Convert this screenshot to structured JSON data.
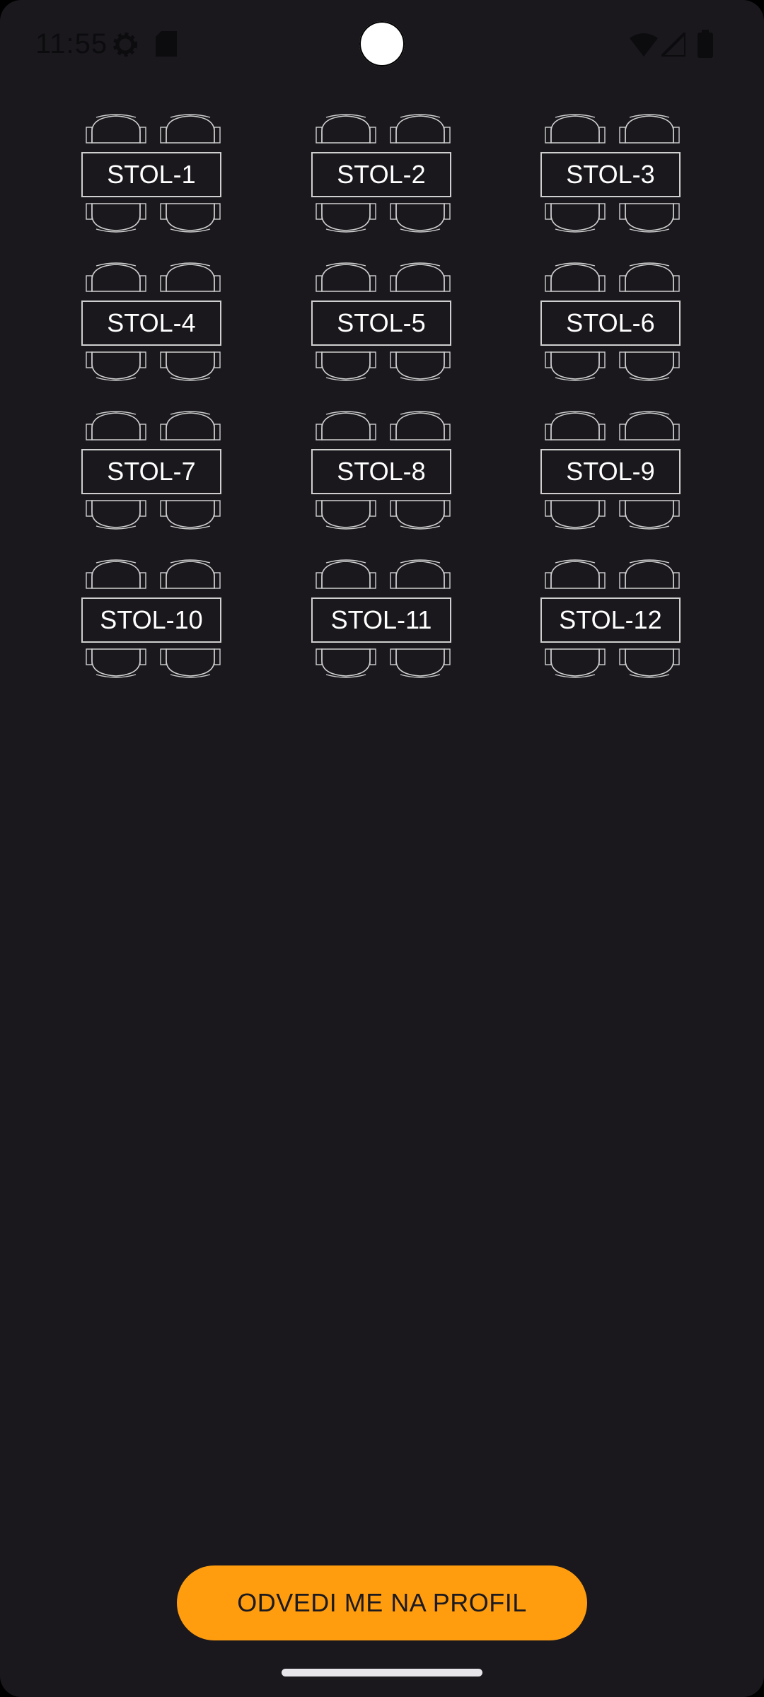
{
  "status_bar": {
    "time": "11:55",
    "icons": [
      "settings-gear-icon",
      "sd-card-icon",
      "wifi-icon",
      "cell-signal-icon",
      "battery-icon"
    ]
  },
  "tables": [
    {
      "label": "STOL-1"
    },
    {
      "label": "STOL-2"
    },
    {
      "label": "STOL-3"
    },
    {
      "label": "STOL-4"
    },
    {
      "label": "STOL-5"
    },
    {
      "label": "STOL-6"
    },
    {
      "label": "STOL-7"
    },
    {
      "label": "STOL-8"
    },
    {
      "label": "STOL-9"
    },
    {
      "label": "STOL-10"
    },
    {
      "label": "STOL-11"
    },
    {
      "label": "STOL-12"
    }
  ],
  "profile_button": {
    "label": "ODVEDI ME NA PROFIL"
  },
  "colors": {
    "background": "#1a181d",
    "accent": "#ff9d0e",
    "table_border": "#cfcfcf",
    "text": "#ffffff"
  }
}
